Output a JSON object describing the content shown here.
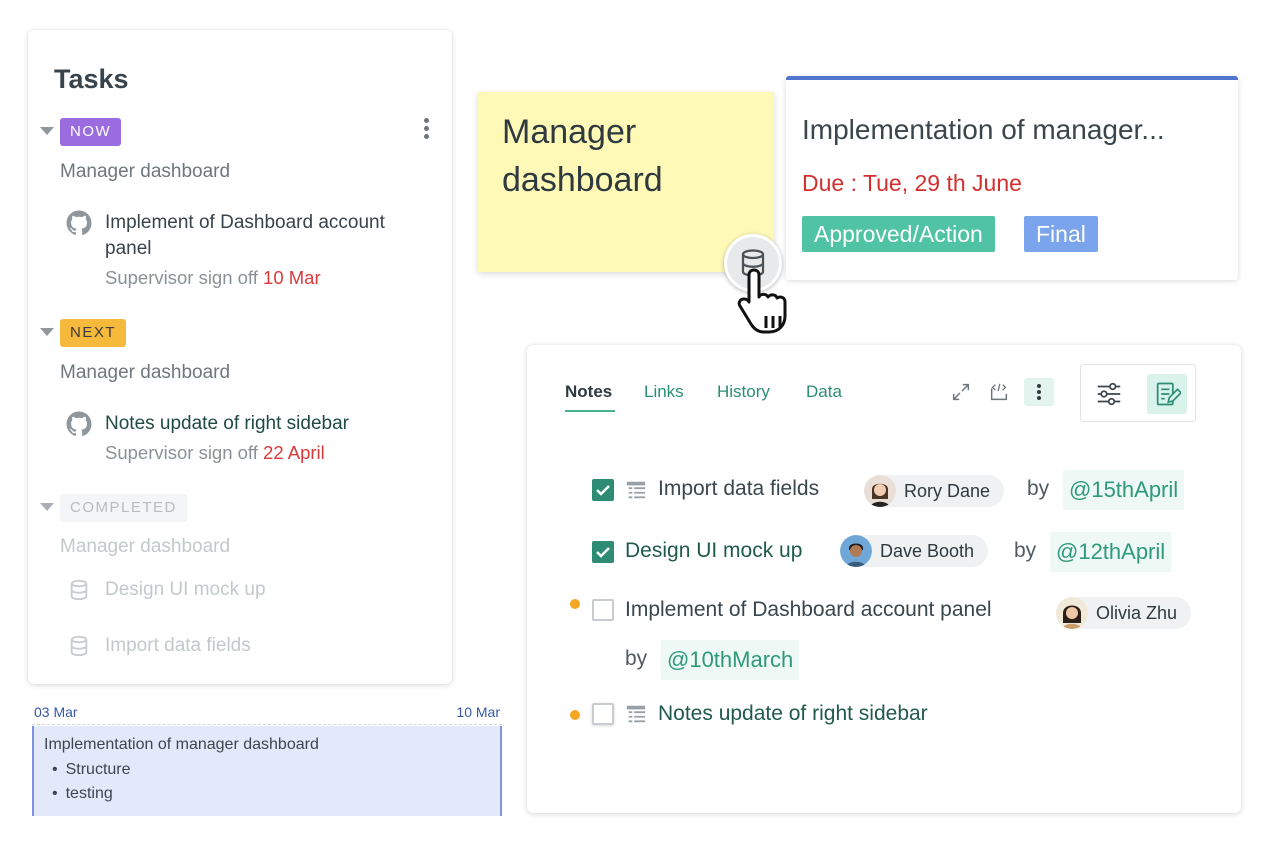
{
  "tasks": {
    "title": "Tasks",
    "groups": [
      {
        "badge": "NOW",
        "project": "Manager dashboard",
        "item_title": "Implement of Dashboard account panel",
        "item_sub_label": "Supervisor sign off",
        "item_sub_date": "10 Mar"
      },
      {
        "badge": "NEXT",
        "project": "Manager dashboard",
        "item_title": "Notes update of right sidebar",
        "item_sub_label": "Supervisor sign off",
        "item_sub_date": "22 April"
      },
      {
        "badge": "COMPLETED",
        "project": "Manager dashboard",
        "items": [
          "Design UI mock up",
          "Import data fields"
        ]
      }
    ]
  },
  "gantt": {
    "start": "03 Mar",
    "end": "10 Mar",
    "bar_title": "Implementation of manager dashboard",
    "bullets": [
      "Structure",
      "testing"
    ]
  },
  "sticky": {
    "text": "Manager dashboard"
  },
  "card": {
    "title": "Implementation of manager...",
    "due": "Due : Tue, 29 th June",
    "chips": [
      "Approved/Action",
      "Final"
    ]
  },
  "notes": {
    "tabs": [
      "Notes",
      "Links",
      "History",
      "Data"
    ],
    "items": [
      {
        "text": "Import data fields",
        "checked": true,
        "user": "Rory Dane",
        "by": "by",
        "date": "@15thApril"
      },
      {
        "text": "Design UI mock up",
        "checked": true,
        "user": "Dave Booth",
        "by": "by",
        "date": "@12thApril"
      },
      {
        "text": "Implement of Dashboard account panel",
        "checked": false,
        "user": "Olivia Zhu",
        "by": "by",
        "date": "@10thMarch"
      },
      {
        "text": "Notes update of right sidebar",
        "checked": false
      }
    ]
  },
  "colors": {
    "accent": "#2e8c74",
    "now": "#9a6ce0",
    "next": "#f5b93b",
    "due": "#d42f2f",
    "approved": "#4fc3a4",
    "final": "#7aa4ec",
    "sticky": "#fff9b8"
  }
}
